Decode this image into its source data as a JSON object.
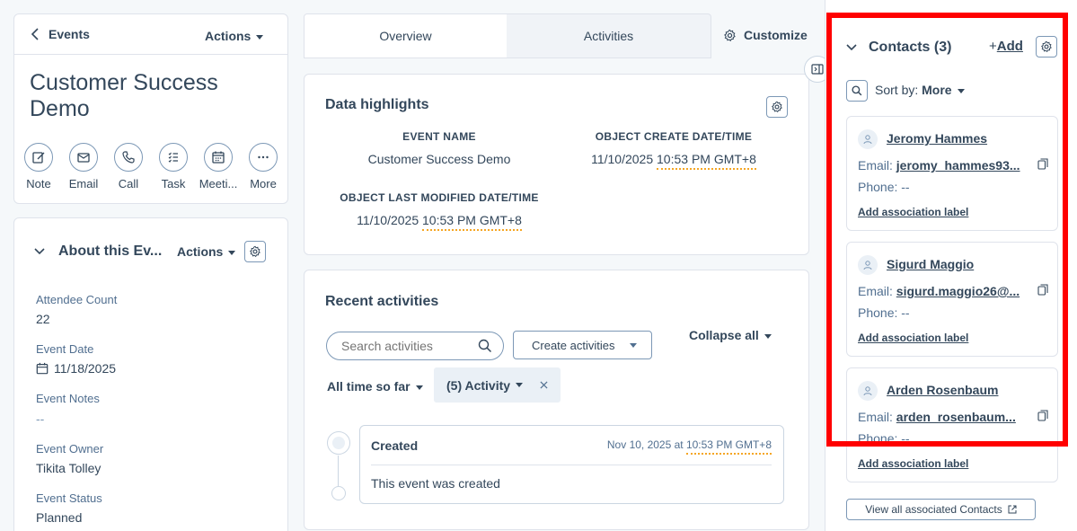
{
  "left": {
    "back_label": "Events",
    "actions_label": "Actions",
    "record_title_line1": "Customer Success",
    "record_title_line2": "Demo",
    "quick_actions": [
      "Note",
      "Email",
      "Call",
      "Task",
      "Meeti...",
      "More"
    ],
    "about_title": "About this Ev...",
    "about_actions": "Actions",
    "fields": [
      {
        "label": "Attendee Count",
        "value": "22"
      },
      {
        "label": "Event Date",
        "value": "11/18/2025"
      },
      {
        "label": "Event Notes",
        "value": "--"
      },
      {
        "label": "Event Owner",
        "value": "Tikita Tolley"
      },
      {
        "label": "Event Status",
        "value": "Planned"
      }
    ]
  },
  "middle": {
    "tabs": [
      "Overview",
      "Activities"
    ],
    "customize_label": "Customize",
    "highlights": {
      "title": "Data highlights",
      "items": [
        {
          "label": "EVENT NAME",
          "value": "Customer Success Demo"
        },
        {
          "label": "OBJECT CREATE DATE/TIME",
          "value_pre": "11/10/2025 ",
          "value_dotted": "10:53 PM GMT+8"
        },
        {
          "label": "OBJECT LAST MODIFIED DATE/TIME",
          "value_pre": "11/10/2025 ",
          "value_dotted": "10:53 PM GMT+8"
        }
      ]
    },
    "recent": {
      "title": "Recent activities",
      "search_placeholder": "Search activities",
      "create_label": "Create activities",
      "collapse_label": "Collapse all",
      "time_filter": "All time so far",
      "activity_filter": "(5) Activity",
      "entry": {
        "title": "Created",
        "date_pre": "Nov 10, 2025 at ",
        "date_dotted": "10:53 PM GMT+8",
        "body": "This event was created"
      }
    }
  },
  "right": {
    "title": "Contacts (3)",
    "add_label": "Add",
    "sort_prefix": "Sort by:",
    "sort_value": "More",
    "email_label": "Email:",
    "phone_label": "Phone:",
    "assoc_label": "Add association label",
    "contacts": [
      {
        "name": "Jeromy Hammes",
        "email": "jeromy_hammes93...",
        "phone": "--"
      },
      {
        "name": "Sigurd Maggio",
        "email": "sigurd.maggio26@...",
        "phone": "--"
      },
      {
        "name": "Arden Rosenbaum",
        "email": "arden_rosenbaum...",
        "phone": "--"
      }
    ],
    "view_all_label": "View all associated Contacts"
  },
  "colors": {
    "highlight_box": "#ff0000",
    "dotted_underline": "#f5a623",
    "text": "#33475b"
  }
}
